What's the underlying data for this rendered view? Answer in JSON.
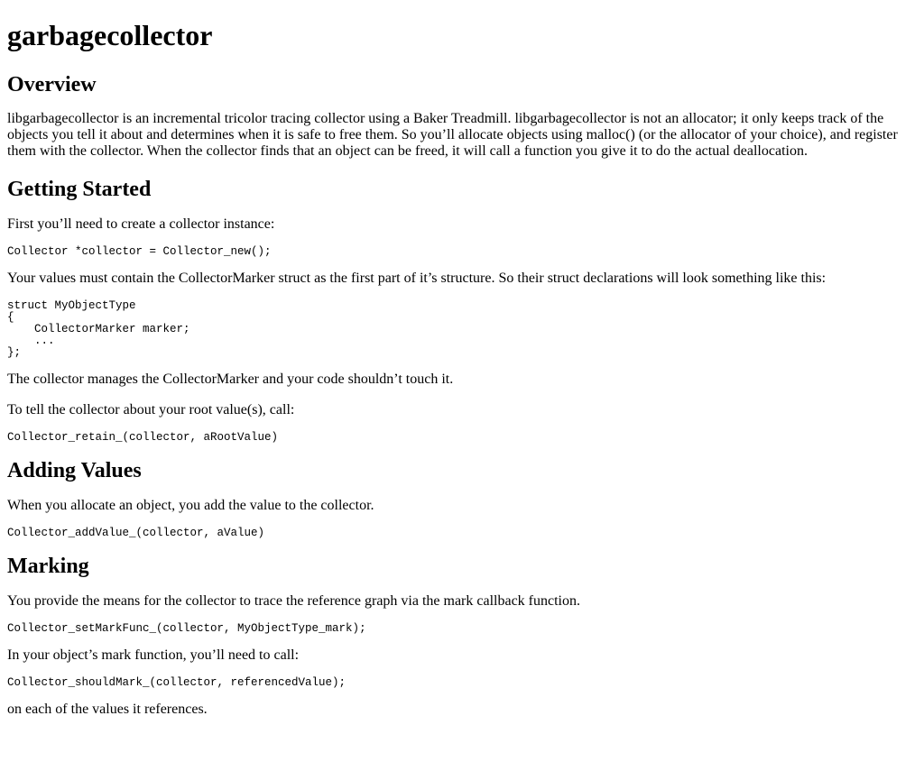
{
  "title": "garbagecollector",
  "overview": {
    "heading": "Overview",
    "paragraph": "libgarbagecollector is an incremental tricolor tracing collector using a Baker Treadmill. libgarbagecollector is not an allocator; it only keeps track of the objects you tell it about and determines when it is safe to free them. So you’ll allocate objects using malloc() (or the allocator of your choice), and register them with the collector. When the collector finds that an object can be freed, it will call a function you give it to do the actual deallocation."
  },
  "getting_started": {
    "heading": "Getting Started",
    "p1": "First you’ll need to create a collector instance:",
    "code1": "Collector *collector = Collector_new();",
    "p2": "Your values must contain the CollectorMarker struct as the first part of it’s structure. So their struct declarations will look something like this:",
    "code2": "struct MyObjectType\n{\n    CollectorMarker marker;\n    ...\n};",
    "p3": "The collector manages the CollectorMarker and your code shouldn’t touch it.",
    "p4": "To tell the collector about your root value(s), call:",
    "code3": "Collector_retain_(collector, aRootValue)"
  },
  "adding_values": {
    "heading": "Adding Values",
    "p1": "When you allocate an object, you add the value to the collector.",
    "code1": "Collector_addValue_(collector, aValue)"
  },
  "marking": {
    "heading": "Marking",
    "p1": "You provide the means for the collector to trace the reference graph via the mark callback function.",
    "code1": "Collector_setMarkFunc_(collector, MyObjectType_mark);",
    "p2": "In your object’s mark function, you’ll need to call:",
    "code2": "Collector_shouldMark_(collector, referencedValue);",
    "p3": "on each of the values it references."
  }
}
